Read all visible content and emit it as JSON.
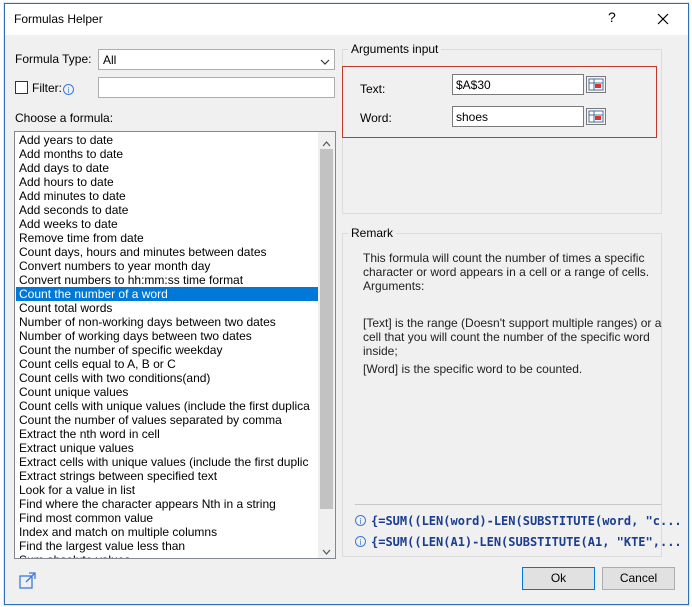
{
  "window": {
    "title": "Formulas Helper",
    "help_glyph": "?"
  },
  "left": {
    "formula_type_label": "Formula Type:",
    "formula_type_value": "All",
    "filter_label": "Filter:",
    "filter_value": "",
    "choose_label": "Choose a formula:",
    "selected_index": 11,
    "formulas": [
      "Add years to date",
      "Add months to date",
      "Add days to date",
      "Add hours to date",
      "Add minutes to date",
      "Add seconds to date",
      "Add weeks to date",
      "Remove time from date",
      "Count days, hours and minutes between dates",
      "Convert numbers to year month day",
      "Convert numbers to hh:mm:ss time format",
      "Count the number of a word",
      "Count total words",
      "Number of non-working days between two dates",
      "Number of working days between two dates",
      "Count the number of specific weekday",
      "Count cells equal to A, B or C",
      "Count cells with two conditions(and)",
      "Count unique values",
      "Count cells with unique values (include the first duplica",
      "Count the number of values separated by comma",
      "Extract the nth word in cell",
      "Extract unique values",
      "Extract cells with unique values (include the first duplic",
      "Extract strings between specified text",
      "Look for a value in list",
      "Find where the character appears Nth in a string",
      "Find most common value",
      "Index and match on multiple columns",
      "Find the largest value less than",
      "Sum absolute values"
    ]
  },
  "arguments": {
    "group_title": "Arguments input",
    "text_label": "Text:",
    "text_value": "$A$30",
    "word_label": "Word:",
    "word_value": "shoes"
  },
  "remark": {
    "group_title": "Remark",
    "paragraph1": "This formula will count the number of times a specific character or word appears in a cell or a range of cells. Arguments:",
    "paragraph2": "[Text] is the range (Doesn't support multiple ranges) or a cell that you will count the number of the specific word inside;",
    "paragraph3": "[Word] is the specific word to be counted.",
    "formula1": "{=SUM((LEN(word)-LEN(SUBSTITUTE(word, \"c...",
    "formula2": "{=SUM((LEN(A1)-LEN(SUBSTITUTE(A1, \"KTE\",..."
  },
  "buttons": {
    "ok": "Ok",
    "cancel": "Cancel"
  },
  "colors": {
    "selection": "#0078d7",
    "highlight_border": "#c0392b",
    "formula_text": "#1a3d8f"
  }
}
